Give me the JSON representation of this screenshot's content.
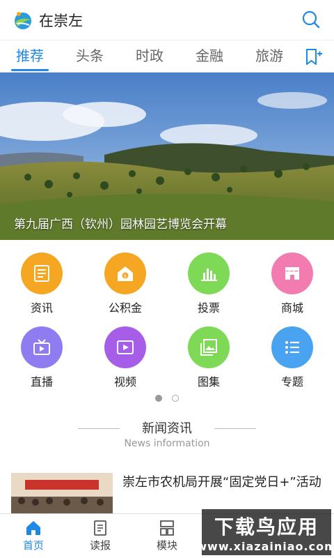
{
  "header": {
    "title": "在崇左",
    "logo_icon": "app-logo",
    "search_icon": "search-icon"
  },
  "tabs": [
    {
      "label": "推荐",
      "active": true
    },
    {
      "label": "头条",
      "active": false
    },
    {
      "label": "时政",
      "active": false
    },
    {
      "label": "金融",
      "active": false
    },
    {
      "label": "旅游",
      "active": false
    }
  ],
  "tab_add_icon": "bookmark-add-icon",
  "banner": {
    "caption": "第九届广西（钦州）园林园艺博览会开幕"
  },
  "features": [
    {
      "label": "资讯",
      "icon": "news-icon",
      "color": "#f5a623"
    },
    {
      "label": "公积金",
      "icon": "house-fund-icon",
      "color": "#f5a623"
    },
    {
      "label": "投票",
      "icon": "vote-icon",
      "color": "#7ed957"
    },
    {
      "label": "商城",
      "icon": "shop-icon",
      "color": "#f27bb0"
    },
    {
      "label": "直播",
      "icon": "live-tv-icon",
      "color": "#8e7cf0"
    },
    {
      "label": "视频",
      "icon": "video-icon",
      "color": "#a65ee8"
    },
    {
      "label": "图集",
      "icon": "gallery-icon",
      "color": "#7ed957"
    },
    {
      "label": "专题",
      "icon": "topic-list-icon",
      "color": "#4aa3f0"
    }
  ],
  "section": {
    "title": "新闻资讯",
    "subtitle": "News information"
  },
  "news": [
    {
      "title": "崇左市农机局开展“固定党日+”活动"
    }
  ],
  "bottom_nav": [
    {
      "label": "首页",
      "icon": "home-icon",
      "active": true
    },
    {
      "label": "读报",
      "icon": "newspaper-icon",
      "active": false
    },
    {
      "label": "模块",
      "icon": "modules-icon",
      "active": false
    }
  ],
  "watermark": {
    "main": "下载鸟应用",
    "sub": "www.xiazainiao.com"
  },
  "colors": {
    "accent": "#1e88e5"
  }
}
